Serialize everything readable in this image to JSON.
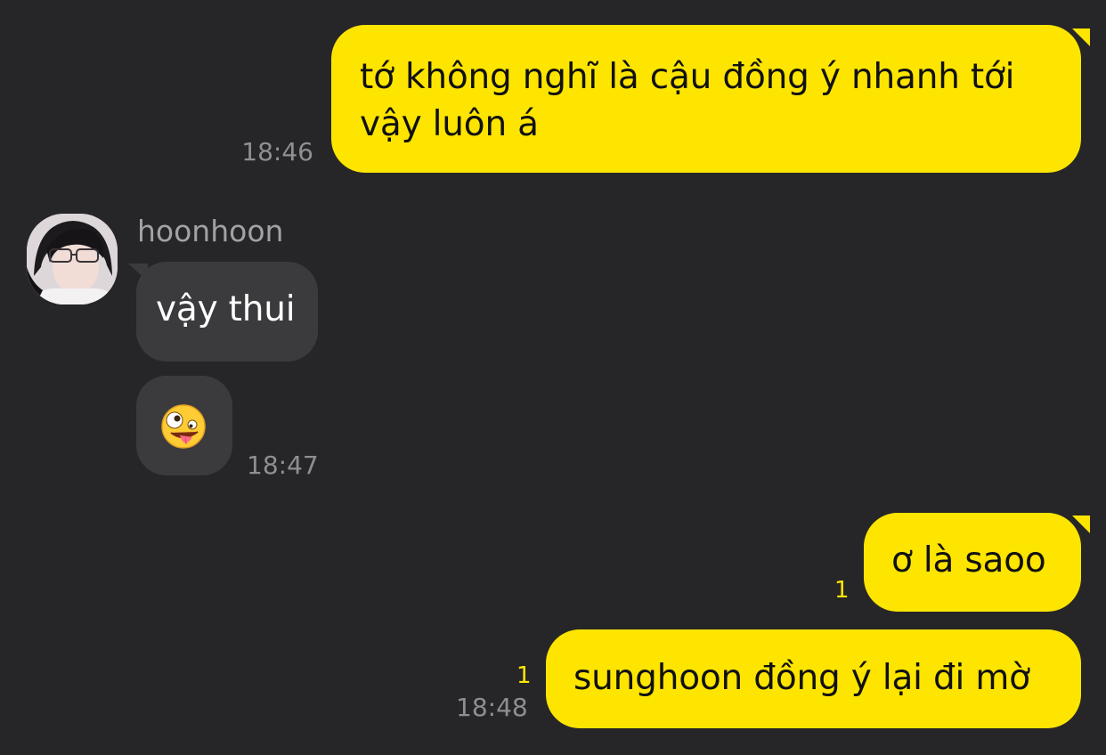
{
  "messages": {
    "m1": {
      "text": "tớ không nghĩ là cậu đồng ý nhanh tới vậy luôn á",
      "time": "18:46"
    },
    "contact": {
      "name": "hoonhoon"
    },
    "m2": {
      "text": "vậy thui"
    },
    "m3": {
      "emoji": "zany-face",
      "time": "18:47"
    },
    "m4": {
      "text": "ơ là saoo",
      "unread": "1"
    },
    "m5": {
      "text": "sunghoon đồng ý lại đi mờ",
      "unread": "1",
      "time": "18:48"
    }
  },
  "colors": {
    "background": "#262628",
    "my_bubble": "#FEE500",
    "their_bubble": "#3b3b3d",
    "unread_count": "#FEE500",
    "timestamp": "#8e8e93"
  }
}
